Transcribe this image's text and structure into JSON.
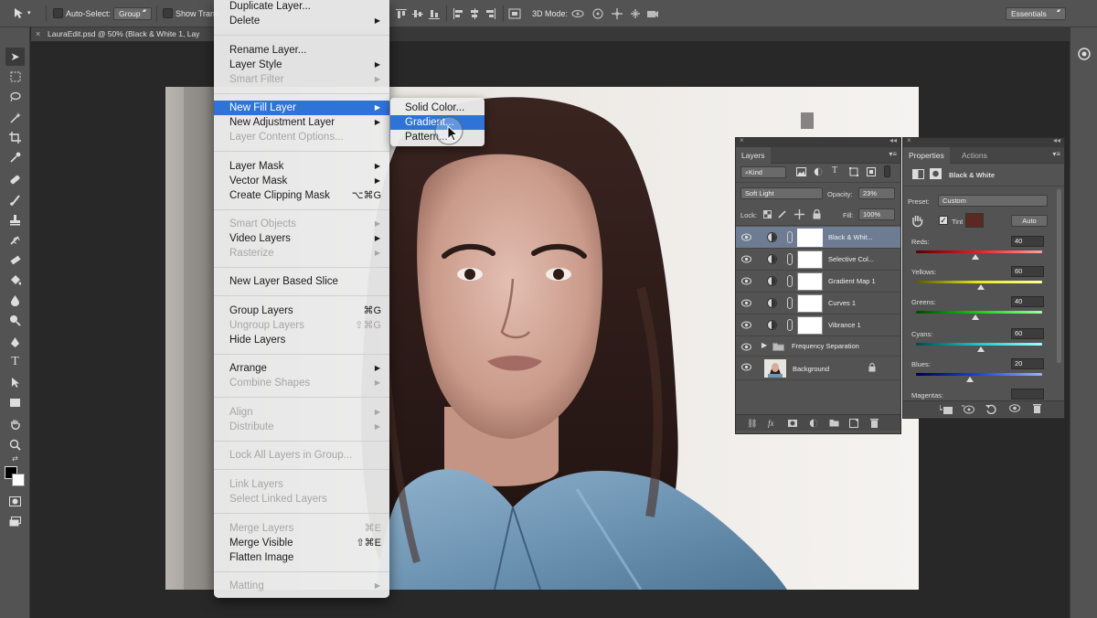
{
  "options_bar": {
    "auto_select_label": "Auto-Select:",
    "auto_select_value": "Group",
    "show_transform_label": "Show Trans",
    "mode_3d_label": "3D Mode:",
    "workspace_value": "Essentials"
  },
  "document_tab": {
    "title": "LauraEdit.psd @ 50% (Black & White 1, Lay"
  },
  "context_menu": {
    "items": [
      {
        "label": "Duplicate Layer...",
        "shortcut": "",
        "submenu": false,
        "disabled": false
      },
      {
        "label": "Delete",
        "shortcut": "",
        "submenu": true,
        "disabled": false
      },
      {
        "label": "Rename Layer...",
        "shortcut": "",
        "submenu": false,
        "disabled": false
      },
      {
        "label": "Layer Style",
        "shortcut": "",
        "submenu": true,
        "disabled": false
      },
      {
        "label": "Smart Filter",
        "shortcut": "",
        "submenu": true,
        "disabled": true
      },
      {
        "label": "New Fill Layer",
        "shortcut": "",
        "submenu": true,
        "disabled": false
      },
      {
        "label": "New Adjustment Layer",
        "shortcut": "",
        "submenu": true,
        "disabled": false
      },
      {
        "label": "Layer Content Options...",
        "shortcut": "",
        "submenu": false,
        "disabled": true
      },
      {
        "label": "Layer Mask",
        "shortcut": "",
        "submenu": true,
        "disabled": false
      },
      {
        "label": "Vector Mask",
        "shortcut": "",
        "submenu": true,
        "disabled": false
      },
      {
        "label": "Create Clipping Mask",
        "shortcut": "⌥⌘G",
        "submenu": false,
        "disabled": false
      },
      {
        "label": "Smart Objects",
        "shortcut": "",
        "submenu": true,
        "disabled": true
      },
      {
        "label": "Video Layers",
        "shortcut": "",
        "submenu": true,
        "disabled": false
      },
      {
        "label": "Rasterize",
        "shortcut": "",
        "submenu": true,
        "disabled": true
      },
      {
        "label": "New Layer Based Slice",
        "shortcut": "",
        "submenu": false,
        "disabled": false
      },
      {
        "label": "Group Layers",
        "shortcut": "⌘G",
        "submenu": false,
        "disabled": false
      },
      {
        "label": "Ungroup Layers",
        "shortcut": "⇧⌘G",
        "submenu": false,
        "disabled": true
      },
      {
        "label": "Hide Layers",
        "shortcut": "",
        "submenu": false,
        "disabled": false
      },
      {
        "label": "Arrange",
        "shortcut": "",
        "submenu": true,
        "disabled": false
      },
      {
        "label": "Combine Shapes",
        "shortcut": "",
        "submenu": true,
        "disabled": true
      },
      {
        "label": "Align",
        "shortcut": "",
        "submenu": true,
        "disabled": true
      },
      {
        "label": "Distribute",
        "shortcut": "",
        "submenu": true,
        "disabled": true
      },
      {
        "label": "Lock All Layers in Group...",
        "shortcut": "",
        "submenu": false,
        "disabled": true
      },
      {
        "label": "Link Layers",
        "shortcut": "",
        "submenu": false,
        "disabled": true
      },
      {
        "label": "Select Linked Layers",
        "shortcut": "",
        "submenu": false,
        "disabled": true
      },
      {
        "label": "Merge Layers",
        "shortcut": "⌘E",
        "submenu": false,
        "disabled": true
      },
      {
        "label": "Merge Visible",
        "shortcut": "⇧⌘E",
        "submenu": false,
        "disabled": false
      },
      {
        "label": "Flatten Image",
        "shortcut": "",
        "submenu": false,
        "disabled": false
      },
      {
        "label": "Matting",
        "shortcut": "",
        "submenu": true,
        "disabled": true
      }
    ],
    "highlighted": "New Fill Layer"
  },
  "fill_submenu": {
    "items": [
      "Solid Color...",
      "Gradient...",
      "Pattern..."
    ],
    "highlighted": "Gradient..."
  },
  "layers_panel": {
    "tab_label": "Layers",
    "kind_filter": "Kind",
    "blend_mode": "Soft Light",
    "opacity_label": "Opacity:",
    "opacity_value": "23%",
    "lock_label": "Lock:",
    "fill_label": "Fill:",
    "fill_value": "100%",
    "layers": [
      {
        "name": "Black & Whit...",
        "selected": true
      },
      {
        "name": "Selective Col...",
        "selected": false
      },
      {
        "name": "Gradient Map 1",
        "selected": false
      },
      {
        "name": "Curves 1",
        "selected": false
      },
      {
        "name": "Vibrance 1",
        "selected": false
      }
    ],
    "group_name": "Frequency Separation",
    "background_name": "Background"
  },
  "properties_panel": {
    "tabs": [
      "Properties",
      "Actions"
    ],
    "title": "Black & White",
    "preset_label": "Preset:",
    "preset_value": "Custom",
    "tint_label": "Tint",
    "tint_color": "#5a2a22",
    "auto_label": "Auto",
    "sliders": [
      {
        "label": "Reds:",
        "value": "40"
      },
      {
        "label": "Yellows:",
        "value": "60"
      },
      {
        "label": "Greens:",
        "value": "40"
      },
      {
        "label": "Cyans:",
        "value": "60"
      },
      {
        "label": "Blues:",
        "value": "20"
      }
    ],
    "last_label": "Magentas:"
  },
  "colors": {
    "menu_highlight": "#2f73d9",
    "selected_layer": "#6d7b93"
  }
}
